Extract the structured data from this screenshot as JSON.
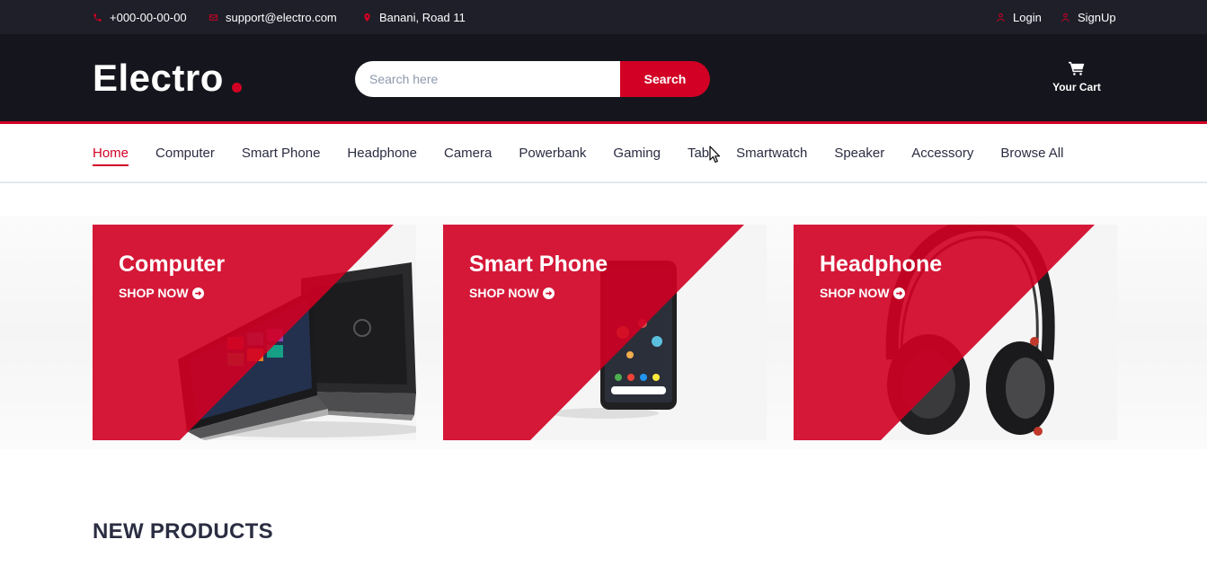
{
  "colors": {
    "accent": "#d10024",
    "top_bar": "#1e1f29",
    "header": "#15161d",
    "text": "#2b2d42"
  },
  "top_bar": {
    "phone": "+000-00-00-00",
    "email": "support@electro.com",
    "address": "Banani, Road 11",
    "login": "Login",
    "signup": "SignUp"
  },
  "header": {
    "logo_text": "Electro",
    "search": {
      "placeholder": "Search here",
      "value": "",
      "button_label": "Search"
    },
    "cart_label": "Your Cart",
    "cart_icon": "shopping-cart-icon"
  },
  "nav": {
    "items": [
      {
        "label": "Home",
        "active": true
      },
      {
        "label": "Computer"
      },
      {
        "label": "Smart Phone"
      },
      {
        "label": "Headphone"
      },
      {
        "label": "Camera"
      },
      {
        "label": "Powerbank"
      },
      {
        "label": "Gaming"
      },
      {
        "label": "Tab"
      },
      {
        "label": "Smartwatch"
      },
      {
        "label": "Speaker"
      },
      {
        "label": "Accessory"
      },
      {
        "label": "Browse All"
      }
    ]
  },
  "categories": [
    {
      "title": "Computer",
      "cta": "SHOP NOW",
      "image_icon": "laptop-image"
    },
    {
      "title": "Smart Phone",
      "cta": "SHOP NOW",
      "image_icon": "smartphone-image"
    },
    {
      "title": "Headphone",
      "cta": "SHOP NOW",
      "image_icon": "headphone-image"
    }
  ],
  "section": {
    "title": "NEW PRODUCTS"
  }
}
